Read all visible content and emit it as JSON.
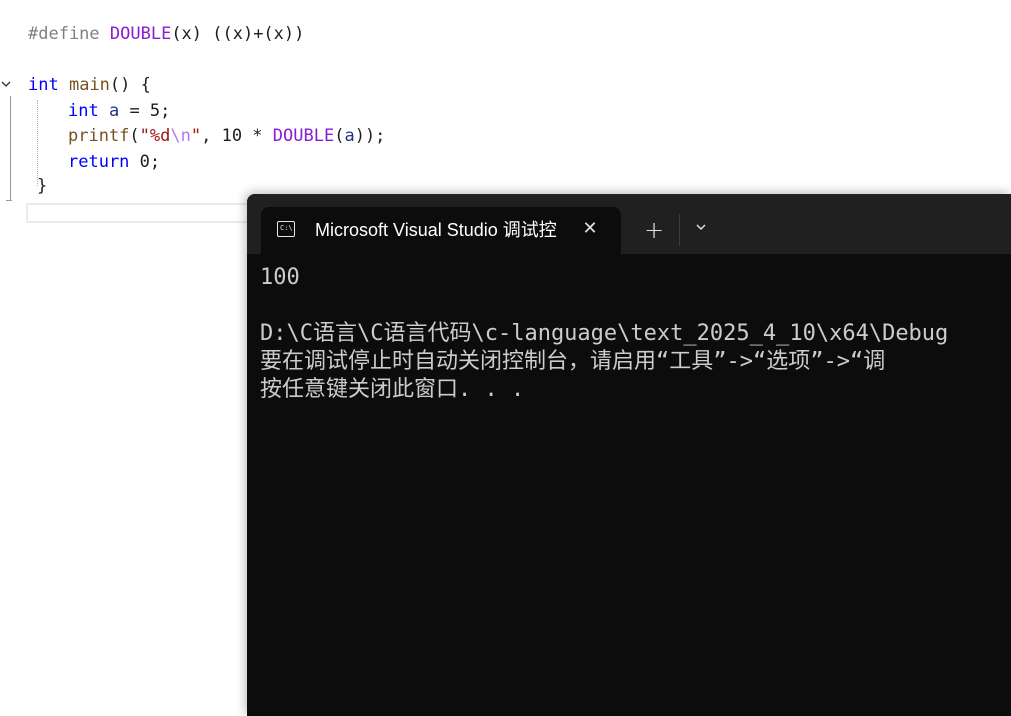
{
  "editor": {
    "line1": {
      "pre": "#define ",
      "macro": "DOUBLE",
      "rest": "(x) ((x)+(x))"
    },
    "line2": {
      "kw": "int",
      "sp": " ",
      "fn": "main",
      "rest": "() {"
    },
    "line3": {
      "kw": "int",
      "sp": " ",
      "var": "a",
      "rest": " = 5;"
    },
    "line4": {
      "fn": "printf",
      "p1": "(",
      "str1": "\"%d",
      "esc": "\\n",
      "str2": "\"",
      "mid": ", 10 * ",
      "macro": "DOUBLE",
      "p2": "(",
      "var": "a",
      "end": "));"
    },
    "line5": {
      "kw": "return",
      "rest": " 0;"
    },
    "line6": {
      "rest": "}"
    }
  },
  "terminal": {
    "tab_title": "Microsoft Visual Studio 调试控",
    "tab_icon_text": "C:\\",
    "close_icon": "✕",
    "new_tab_icon": "+",
    "dropdown_icon": "⌄",
    "output": [
      "100",
      "",
      "D:\\C语言\\C语言代码\\c-language\\text_2025_4_10\\x64\\Debug",
      "要在调试停止时自动关闭控制台，请启用“工具”->“选项”->“调",
      "按任意键关闭此窗口. . ."
    ]
  },
  "colors": {
    "keyword": "#0000ff",
    "macro": "#8a1bd6",
    "function": "#74531f",
    "string": "#a31515",
    "terminal_bg": "#0c0c0c",
    "terminal_text": "#cccccc"
  }
}
